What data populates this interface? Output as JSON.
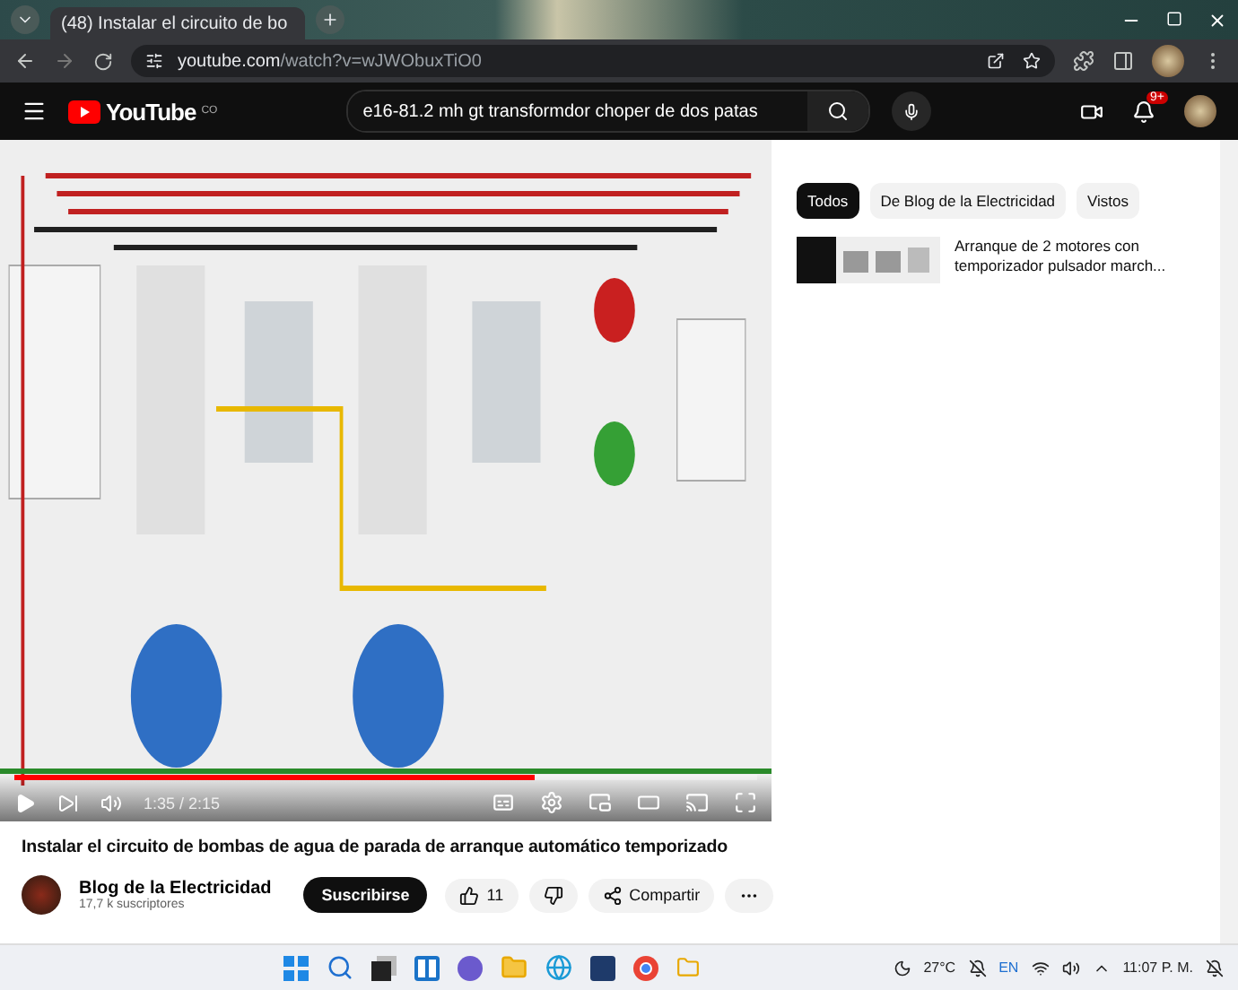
{
  "browser": {
    "tab_title": "(48) Instalar el circuito de bo",
    "url_host": "youtube.com",
    "url_path": "/watch?v=wJWObuxTiO0"
  },
  "header": {
    "logo_text": "YouTube",
    "logo_suffix": "CO",
    "search_value": "e16-81.2 mh gt transformdor choper de dos patas",
    "notifications": "9+"
  },
  "player": {
    "progress": {
      "level": 0.7
    },
    "time": "1:35 / 2:15"
  },
  "video": {
    "title": "Instalar el circuito de bombas de agua de parada de arranque automático temporizado",
    "channel": "Blog de la Electricidad",
    "subscribers": "17,7 k suscriptores",
    "subscribe": "Suscribirse",
    "likes": "11",
    "share": "Compartir"
  },
  "filters": [
    {
      "label": "Todos",
      "selected": true
    },
    {
      "label": "De Blog de la Electricidad",
      "selected": false
    },
    {
      "label": "Vistos",
      "selected": false
    }
  ],
  "recommended": [
    {
      "title": "Arranque de 2 motores con temporizador pulsador march..."
    }
  ],
  "taskbar": {
    "temperature": "27°C",
    "language": "EN",
    "time": "11:07 P. M."
  }
}
